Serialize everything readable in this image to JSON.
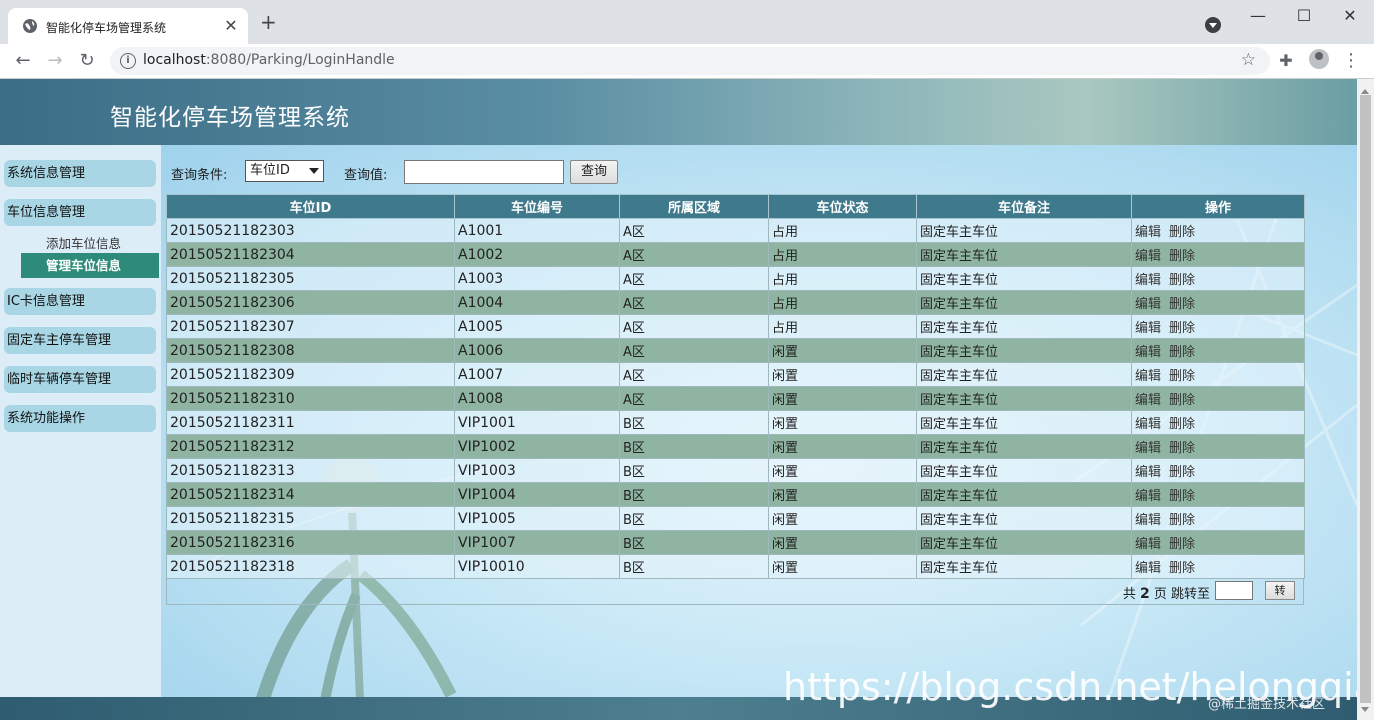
{
  "browser": {
    "tab_title": "智能化停车场管理系统",
    "url_host": "localhost",
    "url_rest": ":8080/Parking/LoginHandle",
    "window_controls": [
      "—",
      "☐",
      "✕"
    ]
  },
  "header": {
    "title": "智能化停车场管理系统"
  },
  "sidebar": {
    "items": [
      "系统信息管理",
      "车位信息管理",
      "IC卡信息管理",
      "固定车主停车管理",
      "临时车辆停车管理",
      "系统功能操作"
    ],
    "subitems": [
      "添加车位信息",
      "管理车位信息"
    ],
    "active_subitem": "管理车位信息"
  },
  "search": {
    "condition_label": "查询条件:",
    "condition_value": "车位ID",
    "value_label": "查询值:",
    "value": "",
    "button_label": "查询"
  },
  "table": {
    "columns": [
      "车位ID",
      "车位编号",
      "所属区域",
      "车位状态",
      "车位备注",
      "操作"
    ],
    "rows": [
      [
        "20150521182303",
        "A1001",
        "A区",
        "占用",
        "固定车主车位"
      ],
      [
        "20150521182304",
        "A1002",
        "A区",
        "占用",
        "固定车主车位"
      ],
      [
        "20150521182305",
        "A1003",
        "A区",
        "占用",
        "固定车主车位"
      ],
      [
        "20150521182306",
        "A1004",
        "A区",
        "占用",
        "固定车主车位"
      ],
      [
        "20150521182307",
        "A1005",
        "A区",
        "占用",
        "固定车主车位"
      ],
      [
        "20150521182308",
        "A1006",
        "A区",
        "闲置",
        "固定车主车位"
      ],
      [
        "20150521182309",
        "A1007",
        "A区",
        "闲置",
        "固定车主车位"
      ],
      [
        "20150521182310",
        "A1008",
        "A区",
        "闲置",
        "固定车主车位"
      ],
      [
        "20150521182311",
        "VIP1001",
        "B区",
        "闲置",
        "固定车主车位"
      ],
      [
        "20150521182312",
        "VIP1002",
        "B区",
        "闲置",
        "固定车主车位"
      ],
      [
        "20150521182313",
        "VIP1003",
        "B区",
        "闲置",
        "固定车主车位"
      ],
      [
        "20150521182314",
        "VIP1004",
        "B区",
        "闲置",
        "固定车主车位"
      ],
      [
        "20150521182315",
        "VIP1005",
        "B区",
        "闲置",
        "固定车主车位"
      ],
      [
        "20150521182316",
        "VIP1007",
        "B区",
        "闲置",
        "固定车主车位"
      ],
      [
        "20150521182318",
        "VIP10010",
        "B区",
        "闲置",
        "固定车主车位"
      ]
    ],
    "edit_label": "编辑",
    "delete_label": "删除"
  },
  "pager": {
    "prefix": "共",
    "total_pages": "2",
    "suffix": "页 跳转至",
    "jump_value": "",
    "go_label": "转"
  },
  "watermark": {
    "url": "https://blog.csdn.net/helongqiang",
    "credit": "@稀土掘金技术社区"
  },
  "colors": {
    "header_bg": "#3f7a8c",
    "row_alt": "#8fb5a2",
    "active_menu": "#2e8b7a",
    "menu_bg": "#a9d6e5"
  }
}
